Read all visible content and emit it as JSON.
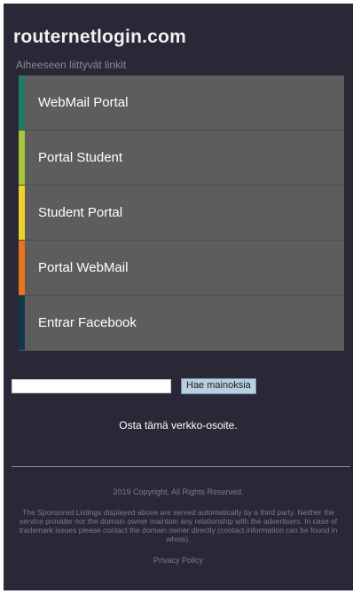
{
  "header": {
    "site_title": "routernetlogin.com",
    "related_label": "Aiheeseen liittyvät linkit"
  },
  "links": [
    {
      "label": "WebMail Portal",
      "accent": "#1e7d68"
    },
    {
      "label": "Portal Student",
      "accent": "#a6c73a"
    },
    {
      "label": "Student Portal",
      "accent": "#f0d22b"
    },
    {
      "label": "Portal WebMail",
      "accent": "#e9741c"
    },
    {
      "label": "Entrar Facebook",
      "accent": "#123747"
    }
  ],
  "search": {
    "value": "",
    "button_label": "Hae mainoksia"
  },
  "buy_domain_label": "Osta tämä verkko-osoite.",
  "footer": {
    "copyright": "2019 Copyright. All Rights Reserved.",
    "disclaimer": "The Sponsored Listings displayed above are served automatically by a third party. Neither the service provider nor the domain owner maintain any relationship with the advertisers. In case of trademark issues please contact the domain owner directly (contact information can be found in whois).",
    "privacy_label": "Privacy Policy"
  }
}
